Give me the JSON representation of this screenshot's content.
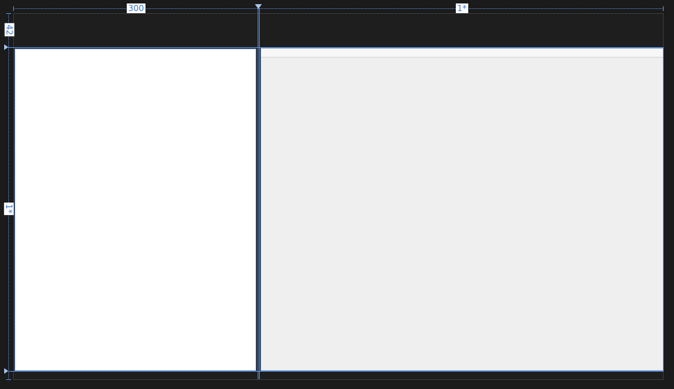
{
  "columns": {
    "left_width_label": "300",
    "right_width_label": "1*"
  },
  "rows": {
    "top_height_label": "42",
    "bottom_height_label": "1*"
  },
  "colors": {
    "guide": "#5b8fd6",
    "surface": "#1e1e1e",
    "left_panel": "#ffffff",
    "right_panel": "#efefef"
  }
}
